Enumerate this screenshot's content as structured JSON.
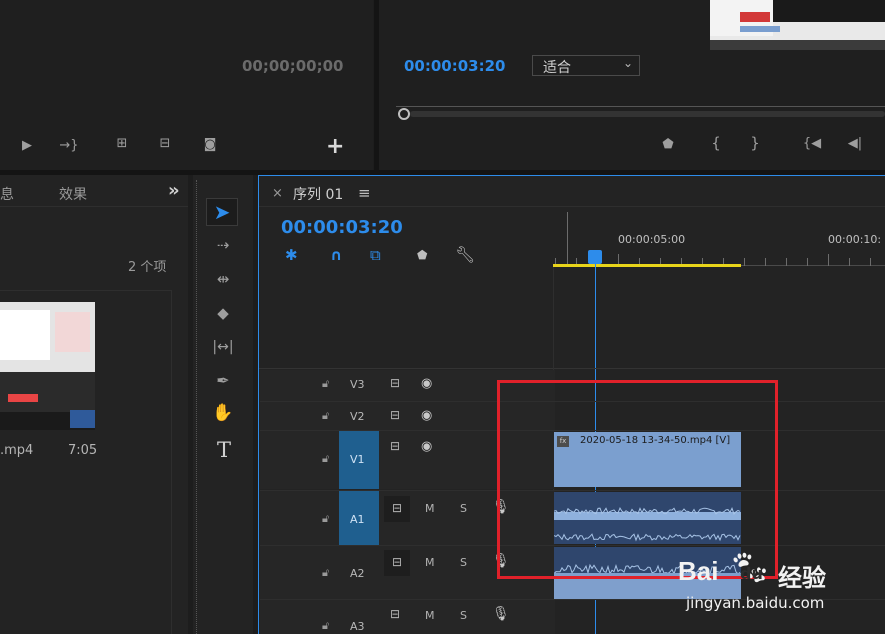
{
  "source_monitor": {
    "timecode": "00;00;00;00",
    "add_icon": "+"
  },
  "program_monitor": {
    "timecode": "00:00:03:20",
    "fit_select": "适合"
  },
  "project_panel": {
    "tab_partial": "息",
    "tab_effects": "效果",
    "more_icon": "»",
    "item_count": "2 个项",
    "clip_name_partial": ".mp4",
    "clip_duration": "7:05"
  },
  "sequence": {
    "close_icon": "×",
    "title": "序列 01",
    "menu_icon": "≡",
    "timecode": "00:00:03:20",
    "ruler_label_1": "00:00:05:00",
    "ruler_label_2": "00:00:10:"
  },
  "tracks": {
    "v3": "V3",
    "v2": "V2",
    "v1_source": "V1",
    "a1_source": "A1",
    "a2": "A2",
    "a3": "A3",
    "mute": "M",
    "solo": "S"
  },
  "clip": {
    "video_label": "2020-05-18 13-34-50.mp4 [V]",
    "fx": "fx"
  },
  "watermark": {
    "brand": "Bai",
    "brand2": "du",
    "brand_cn": "经验",
    "url": "jingyan.baidu.com"
  },
  "colors": {
    "accent_blue": "#2d8ceb",
    "track_target_blue": "#1f5f8f",
    "clip_video": "#7b9fcf",
    "clip_audio": "#2f466d",
    "work_area_yellow": "#e8d41a",
    "highlight_red": "#e0212a"
  }
}
